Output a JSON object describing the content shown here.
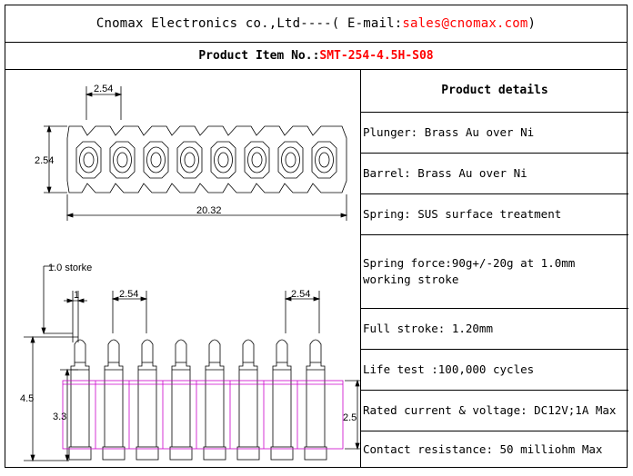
{
  "header": {
    "company": "Cnomax Electronics co.,Ltd----( E-mail: ",
    "email": "sales@cnomax.com",
    "close": ")"
  },
  "item": {
    "label": "Product Item No.: ",
    "number": "SMT-254-4.5H-S08"
  },
  "drawing": {
    "top_view": {
      "pitch": "2.54",
      "height": "2.54",
      "length": "20.32"
    },
    "side_view": {
      "stroke_label": "1.0 storke",
      "pitch_left": "2.54",
      "pitch_right": "2.54",
      "gap": "1",
      "total_height": "4.5",
      "barrel_height": "3.3",
      "body_height": "2.5"
    }
  },
  "details": {
    "title": "Product details",
    "rows": [
      "Plunger: Brass Au over Ni",
      "Barrel: Brass Au over Ni",
      "Spring: SUS surface treatment",
      "Spring force:90g+/-20g at 1.0mm working stroke",
      "Full stroke: 1.20mm",
      "Life test :100,000 cycles",
      "Rated current & voltage: DC12V;1A Max",
      "Contact resistance: 50 milliohm Max"
    ]
  },
  "colors": {
    "email": "#ff0000",
    "item_number": "#ff0000",
    "body_outline": "#cc00cc"
  }
}
